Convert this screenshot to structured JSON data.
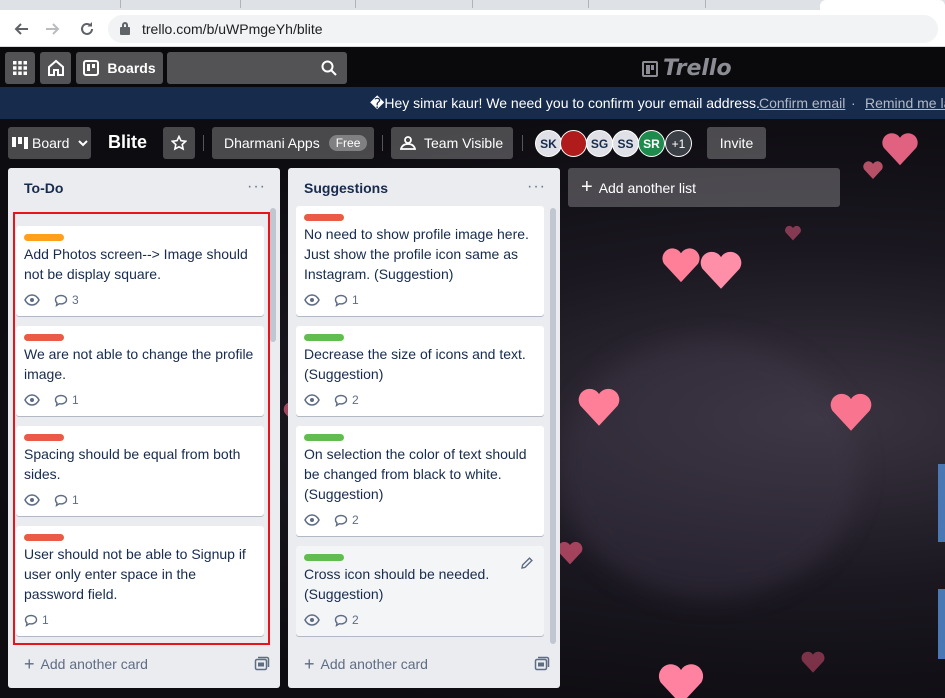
{
  "browser": {
    "url": "trello.com/b/uWPmgeYh/blite"
  },
  "header": {
    "boards_label": "Boards",
    "logo_text": "Trello"
  },
  "notice": {
    "message": "�Hey simar kaur! We need you to confirm your email address.",
    "confirm_link": "Confirm email",
    "separator": "·",
    "remind_link": "Remind me la"
  },
  "board": {
    "view_label": "Board",
    "title": "Blite",
    "team_name": "Dharmani Apps",
    "team_badge": "Free",
    "visibility_label": "Team Visible",
    "members": [
      {
        "initials": "SK",
        "bg": "#dfe1e6",
        "fg": "#172b4d"
      },
      {
        "initials": "",
        "bg": "#b01c1c",
        "fg": "#ffffff"
      },
      {
        "initials": "SG",
        "bg": "#dfe1e6",
        "fg": "#172b4d"
      },
      {
        "initials": "SS",
        "bg": "#dfe1e6",
        "fg": "#172b4d"
      },
      {
        "initials": "SR",
        "bg": "#1e8a4c",
        "fg": "#ffffff"
      }
    ],
    "extra_members": "+1",
    "invite_label": "Invite"
  },
  "lists": [
    {
      "title": "To-Do",
      "menu": "···",
      "add_card_label": "Add another card",
      "cards": [
        {
          "label_color": "#ff9f1a",
          "text": "Add Photos screen--> Image should not be display square.",
          "watch": true,
          "comments": "3"
        },
        {
          "label_color": "#eb5a46",
          "text": "We are not able to change the profile image.",
          "watch": true,
          "comments": "1"
        },
        {
          "label_color": "#eb5a46",
          "text": "Spacing should be equal from both sides.",
          "watch": true,
          "comments": "1"
        },
        {
          "label_color": "#eb5a46",
          "text": "User should not be able to Signup if user only enter space in the password field.",
          "watch": false,
          "comments": "1"
        }
      ]
    },
    {
      "title": "Suggestions",
      "menu": "···",
      "add_card_label": "Add another card",
      "cards": [
        {
          "label_color": "#eb5a46",
          "text": "No need to show profile image here. Just show the profile icon same as Instagram. (Suggestion)",
          "watch": true,
          "comments": "1"
        },
        {
          "label_color": "#61bd4f",
          "text": "Decrease the size of icons and text. (Suggestion)",
          "watch": true,
          "comments": "2"
        },
        {
          "label_color": "#61bd4f",
          "text": "On selection the color of text should be changed from black to white. (Suggestion)",
          "watch": true,
          "comments": "2"
        },
        {
          "label_color": "#61bd4f",
          "text": "Cross icon should be needed. (Suggestion)",
          "watch": true,
          "comments": "2"
        }
      ]
    }
  ],
  "add_list_label": "Add another list",
  "colors": {
    "header_bg": "#0a0a0c",
    "notice_bg": "#172b4d",
    "list_bg": "#ebecf0",
    "highlight": "#e8141b"
  }
}
